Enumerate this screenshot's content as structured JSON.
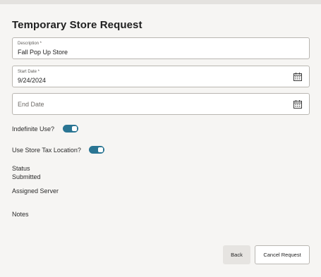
{
  "page": {
    "title": "Temporary Store Request"
  },
  "form": {
    "description": {
      "label": "Description *",
      "value": "Fall Pop Up Store"
    },
    "start_date": {
      "label": "Start Date *",
      "value": "9/24/2024"
    },
    "end_date": {
      "placeholder": "End Date"
    },
    "indefinite_use": {
      "label": "Indefinite Use?",
      "checked": true
    },
    "use_store_tax": {
      "label": "Use Store Tax Location?",
      "checked": true
    },
    "status": {
      "label": "Status",
      "value": "Submitted"
    },
    "assigned_server": {
      "label": "Assigned Server"
    },
    "notes": {
      "label": "Notes"
    }
  },
  "actions": {
    "back_label": "Back",
    "cancel_label": "Cancel Request"
  },
  "colors": {
    "toggle_on": "#2a7593",
    "background": "#f6f5f3"
  },
  "icons": {
    "calendar": "calendar-icon"
  }
}
